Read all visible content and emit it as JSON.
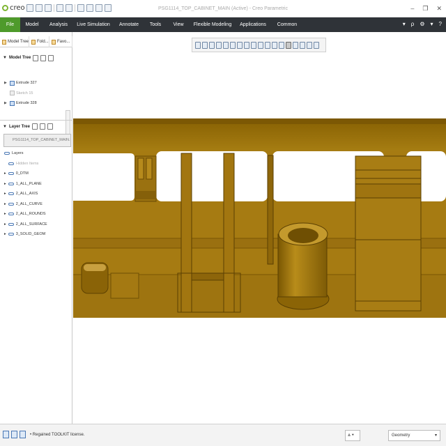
{
  "app": {
    "logo_text": "creo",
    "window_title": "PSG1114_TOP_CABINET_MAIN (Active) - Creo Parametric",
    "window_controls": [
      "–",
      "❐",
      "✕"
    ]
  },
  "menu": {
    "tabs": [
      "File",
      "Model",
      "Analysis",
      "Live Simulation",
      "Annotate",
      "Tools",
      "View",
      "Flexible Modeling",
      "Applications",
      "Common"
    ],
    "right_icons": [
      "▾",
      "ρ",
      "⚙",
      "▾",
      "?"
    ]
  },
  "panel": {
    "tabs": [
      "Model Tree",
      "Fold...",
      "Favo..."
    ],
    "model_tree_label": "Model Tree",
    "model_tree_items": [
      {
        "label": "Extrude 327",
        "dim": false
      },
      {
        "label": "Sketch 15",
        "dim": true
      },
      {
        "label": "Extrude 328",
        "dim": false
      }
    ],
    "layer_tree_label": "Layer Tree",
    "layer_dropdown": "PSG1114_TOP_CABINET_MAIN.PRT",
    "layers_root": "Layers",
    "layers": [
      {
        "label": "Hidden Items",
        "dim": true
      },
      {
        "label": "0_DTM",
        "dim": false
      },
      {
        "label": "1_ALL_PLANE",
        "dim": false
      },
      {
        "label": "2_ALL_AXIS",
        "dim": false
      },
      {
        "label": "2_ALL_CURVE",
        "dim": false
      },
      {
        "label": "2_ALL_ROUNDS",
        "dim": false
      },
      {
        "label": "2_ALL_SURFACE",
        "dim": false
      },
      {
        "label": "3_SOLID_GEOM",
        "dim": false
      }
    ]
  },
  "status": {
    "message": "• Regained TOOLKIT license.",
    "filter_label": "Geometry",
    "filter_arrow": "▾"
  },
  "colors": {
    "menubar": "#2f3338",
    "file_tab": "#4e9a2b",
    "model_gold": "#a87a12"
  }
}
